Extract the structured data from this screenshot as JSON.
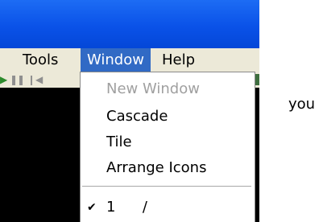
{
  "menubar": {
    "items": [
      "Tools",
      "Window",
      "Help"
    ]
  },
  "window_menu": {
    "new_window": "New Window",
    "cascade": "Cascade",
    "tile": "Tile",
    "arrange_icons": "Arrange Icons",
    "window_1_number": "1",
    "window_1_name": "/",
    "check_mark": "✔"
  },
  "side_text": "you",
  "colors": {
    "titlebar": "#0a52e8",
    "menu_highlight": "#316ac5",
    "menubar_bg": "#ece9d8"
  },
  "icons": [
    "play-icon",
    "pause-icon",
    "step-back-icon",
    "checkmark-icon"
  ]
}
